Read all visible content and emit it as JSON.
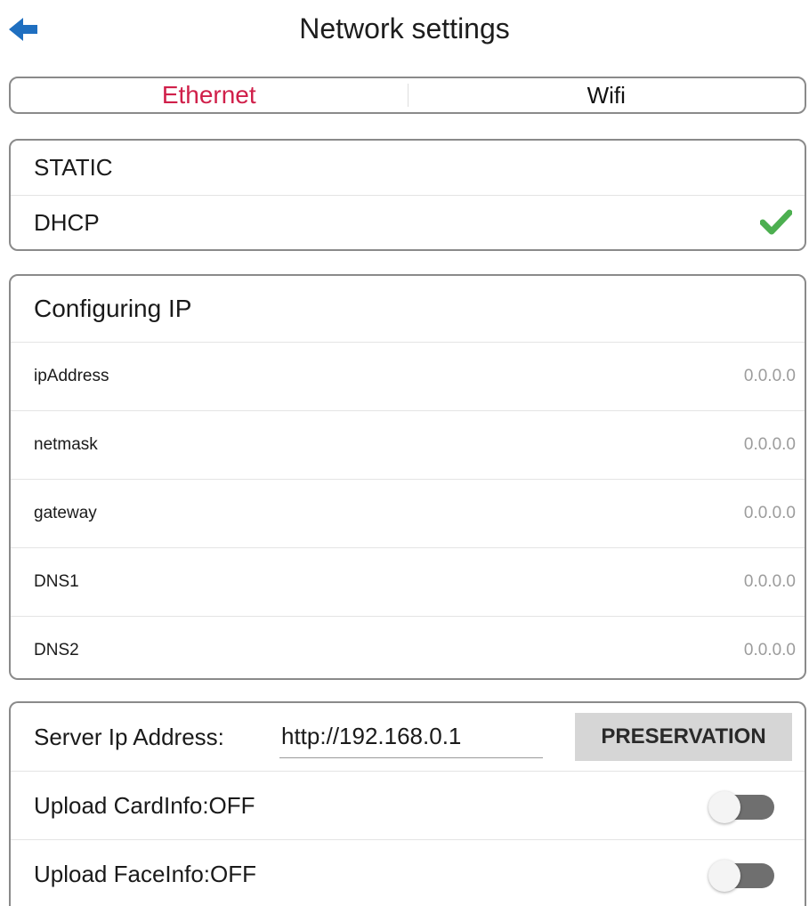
{
  "header": {
    "title": "Network settings",
    "back_icon": "back-arrow-icon"
  },
  "tabs": [
    {
      "label": "Ethernet",
      "active": true
    },
    {
      "label": "Wifi",
      "active": false
    }
  ],
  "mode": {
    "options": [
      {
        "label": "STATIC",
        "selected": false
      },
      {
        "label": "DHCP",
        "selected": true
      }
    ],
    "check_icon": "check-icon"
  },
  "ip_config": {
    "title": "Configuring IP",
    "fields": [
      {
        "label": "ipAddress",
        "value": "0.0.0.0"
      },
      {
        "label": "netmask",
        "value": "0.0.0.0"
      },
      {
        "label": "gateway",
        "value": "0.0.0.0"
      },
      {
        "label": "DNS1",
        "value": "0.0.0.0"
      },
      {
        "label": "DNS2",
        "value": "0.0.0.0"
      }
    ]
  },
  "server": {
    "label": "Server Ip Address:",
    "value": "http://192.168.0.1",
    "button_label": "PRESERVATION",
    "toggles": [
      {
        "label": "Upload CardInfo:OFF",
        "on": false
      },
      {
        "label": "Upload FaceInfo:OFF",
        "on": false
      }
    ]
  },
  "colors": {
    "accent": "#d0204a",
    "check": "#4caf50",
    "back_arrow": "#1f6fc0",
    "muted_value": "#9c9c9c"
  }
}
